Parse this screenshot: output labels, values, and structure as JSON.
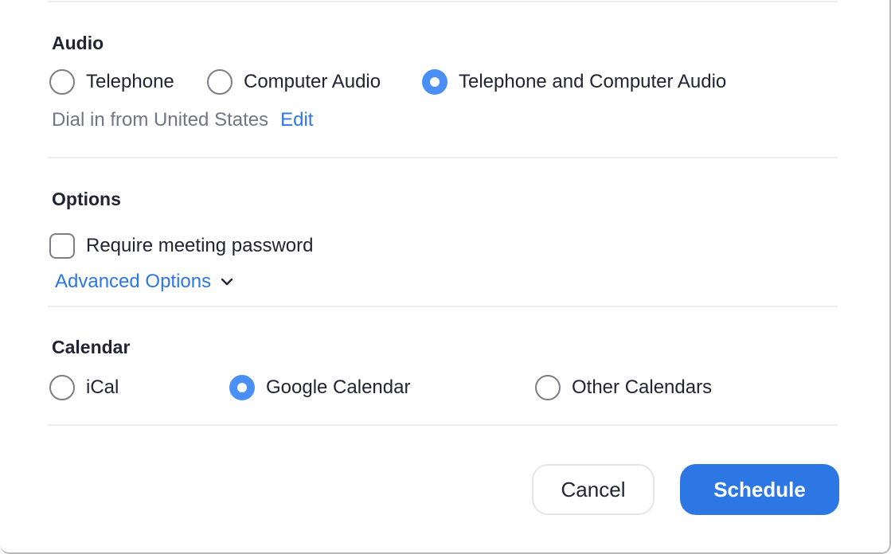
{
  "audio": {
    "title": "Audio",
    "options": [
      {
        "label": "Telephone",
        "selected": false
      },
      {
        "label": "Computer Audio",
        "selected": false
      },
      {
        "label": "Telephone and Computer Audio",
        "selected": true
      }
    ],
    "dial_in_text": "Dial in from United States",
    "edit_link": "Edit"
  },
  "options": {
    "title": "Options",
    "require_password": {
      "label": "Require meeting password",
      "checked": false
    },
    "advanced_options_label": "Advanced Options",
    "advanced_icon": "chevron-down-icon"
  },
  "calendar": {
    "title": "Calendar",
    "options": [
      {
        "label": "iCal",
        "selected": false
      },
      {
        "label": "Google Calendar",
        "selected": true
      },
      {
        "label": "Other Calendars",
        "selected": false
      }
    ]
  },
  "footer": {
    "cancel_label": "Cancel",
    "schedule_label": "Schedule"
  },
  "colors": {
    "accent": "#2d77e4",
    "radio_selected": "#4a8ff5",
    "text": "#232333",
    "muted": "#747487",
    "separator": "#ededf1"
  }
}
